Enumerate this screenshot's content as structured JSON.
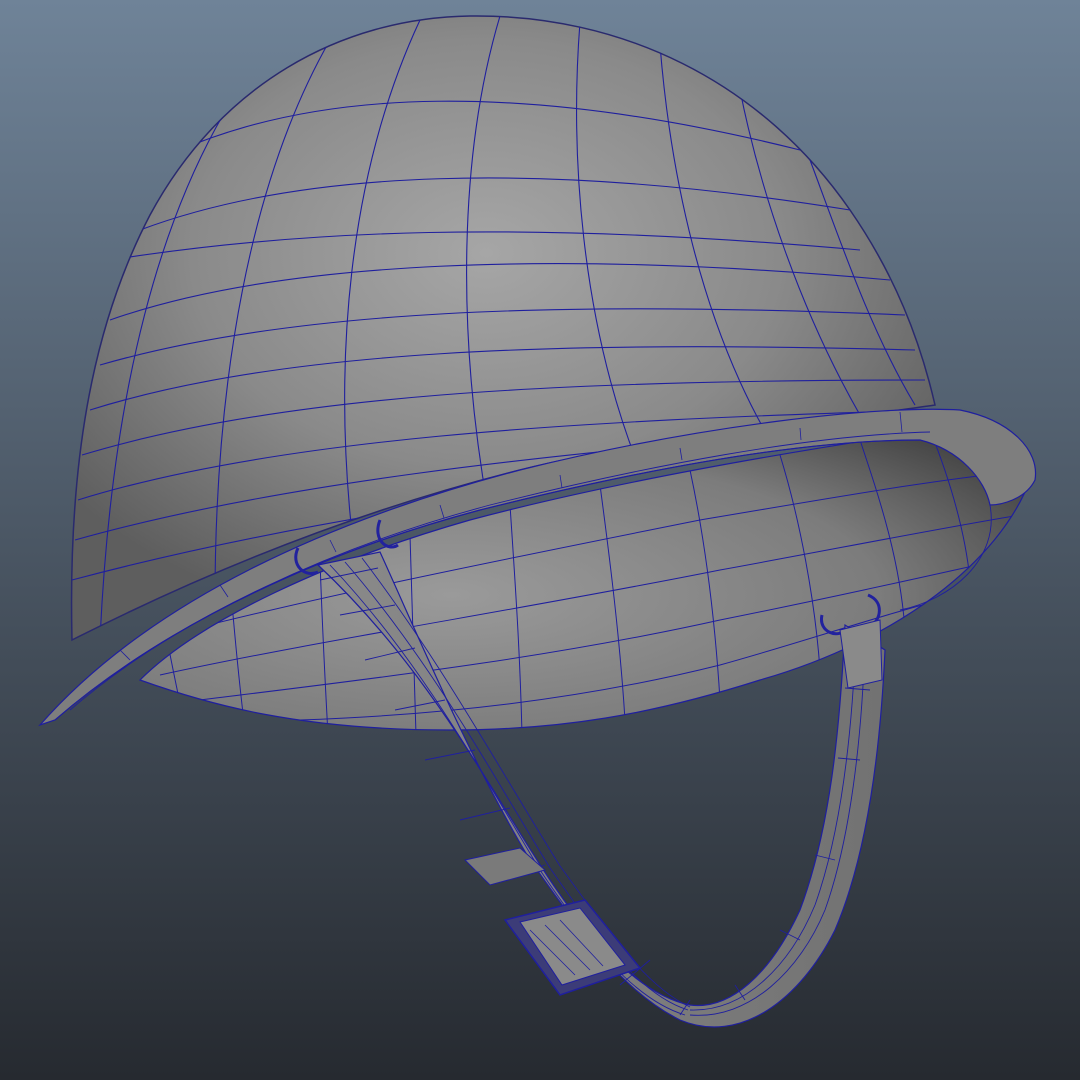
{
  "viewport": {
    "background_top": "#6f8398",
    "background_bottom": "#262a30",
    "shading_mode": "smooth-shaded-with-wireframe"
  },
  "model": {
    "subject": "helmet",
    "parts": [
      "shell",
      "brim",
      "inner-liner",
      "bail-loops",
      "chin-strap",
      "strap-buckle"
    ],
    "surface_color": "#8a8a8a",
    "wire_color": "#1f1f9e"
  }
}
